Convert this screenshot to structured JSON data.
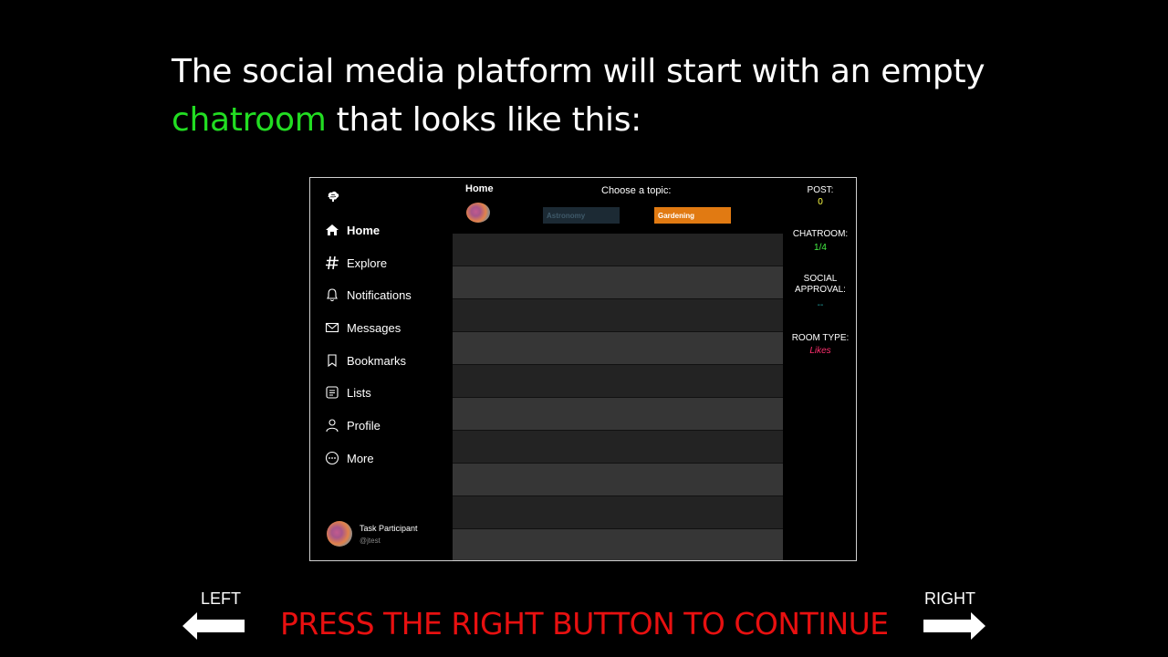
{
  "headline": {
    "line1": "The social media platform will start with an empty",
    "highlight": "chatroom",
    "line2_rest": " that looks like this:"
  },
  "app": {
    "sidebar": {
      "items": [
        {
          "label": "Home",
          "icon": "home-icon"
        },
        {
          "label": "Explore",
          "icon": "hashtag-icon"
        },
        {
          "label": "Notifications",
          "icon": "bell-icon"
        },
        {
          "label": "Messages",
          "icon": "envelope-icon"
        },
        {
          "label": "Bookmarks",
          "icon": "bookmark-icon"
        },
        {
          "label": "Lists",
          "icon": "list-icon"
        },
        {
          "label": "Profile",
          "icon": "user-icon"
        },
        {
          "label": "More",
          "icon": "more-icon"
        }
      ],
      "user": {
        "name": "Task Participant",
        "handle": "@jtest"
      }
    },
    "main": {
      "title": "Home",
      "topic_prompt": "Choose a topic:",
      "topics": [
        "Astronomy",
        "Gardening"
      ],
      "selected_topic": "Gardening"
    },
    "stats": {
      "post_label": "POST:",
      "post_value": "0",
      "chatroom_label": "CHATROOM:",
      "chatroom_value": "1/4",
      "approval_label_1": "SOCIAL",
      "approval_label_2": "APPROVAL:",
      "approval_value": "--",
      "roomtype_label": "ROOM TYPE:",
      "roomtype_value": "Likes"
    },
    "colors": {
      "post_value": "#ffff44",
      "chatroom_value": "#44ee44",
      "approval_value": "#22aaaa",
      "roomtype_value": "#ff2f6e",
      "gardening": "#e17a12"
    }
  },
  "footer": {
    "left_label": "LEFT",
    "right_label": "RIGHT",
    "cta": "PRESS THE RIGHT BUTTON TO CONTINUE"
  }
}
